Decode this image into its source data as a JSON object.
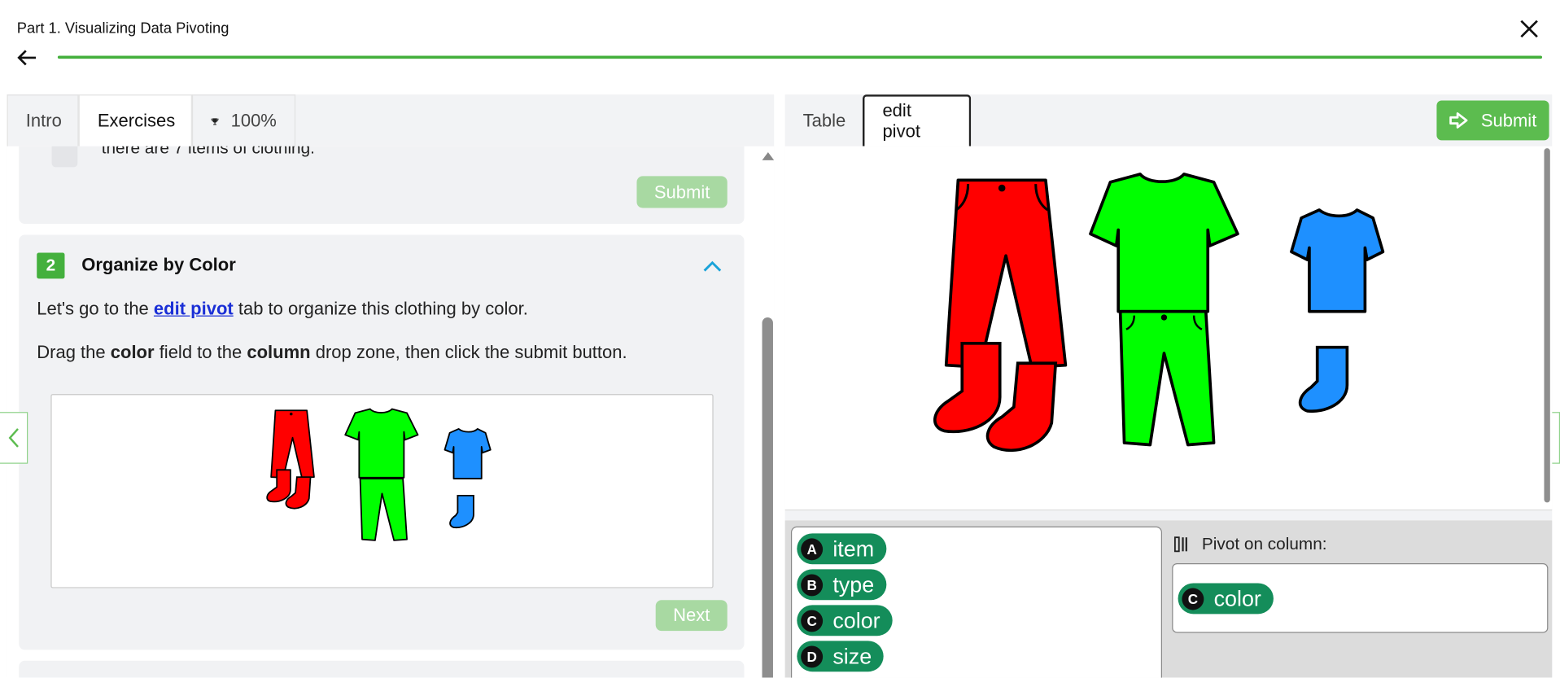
{
  "header": {
    "title": "Part 1. Visualizing Data Pivoting",
    "progress_fraction": 1.0
  },
  "left": {
    "tabs": [
      {
        "label": "Intro"
      },
      {
        "label": "Exercises"
      },
      {
        "label": "100%",
        "icon": "trophy-icon"
      }
    ],
    "card1": {
      "text": "there are 7 items of clothing.",
      "submit_label": "Submit"
    },
    "card2": {
      "step": "2",
      "title": "Organize by Color",
      "p1_before": "Let's go to the ",
      "p1_link": "edit pivot",
      "p1_after": " tab to organize this clothing by color.",
      "p2_a": "Drag the ",
      "p2_b": "color",
      "p2_c": " field to the ",
      "p2_d": "column",
      "p2_e": " drop zone, then click the submit button.",
      "next_label": "Next"
    }
  },
  "right": {
    "tabs": [
      {
        "label": "Table"
      },
      {
        "label": "edit pivot"
      }
    ],
    "submit_label": "Submit",
    "fields": [
      {
        "badge": "A",
        "label": "item"
      },
      {
        "badge": "B",
        "label": "type"
      },
      {
        "badge": "C",
        "label": "color"
      },
      {
        "badge": "D",
        "label": "size"
      }
    ],
    "pivot_label": "Pivot on column:",
    "pivot_field": {
      "badge": "C",
      "label": "color"
    }
  },
  "colors": {
    "accent_green": "#44b03d",
    "pill_green": "#148d5a",
    "red": "#ff0000",
    "green": "#00ff00",
    "blue": "#1e90ff"
  }
}
